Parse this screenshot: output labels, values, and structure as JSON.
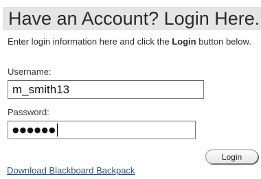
{
  "header": {
    "title": "Have an Account? Login Here."
  },
  "intro": {
    "text_before": "Enter login information here and click the ",
    "bold_word": "Login",
    "text_after": " button below."
  },
  "form": {
    "username_label": "Username:",
    "username_value": "m_smith13",
    "password_label": "Password:",
    "password_mask": "●●●●●●",
    "login_label": "Login"
  },
  "links": {
    "download_label": "Download Blackboard Backpack"
  },
  "colors": {
    "header_background": "#e5e5e5",
    "link": "#2d4f8c"
  }
}
